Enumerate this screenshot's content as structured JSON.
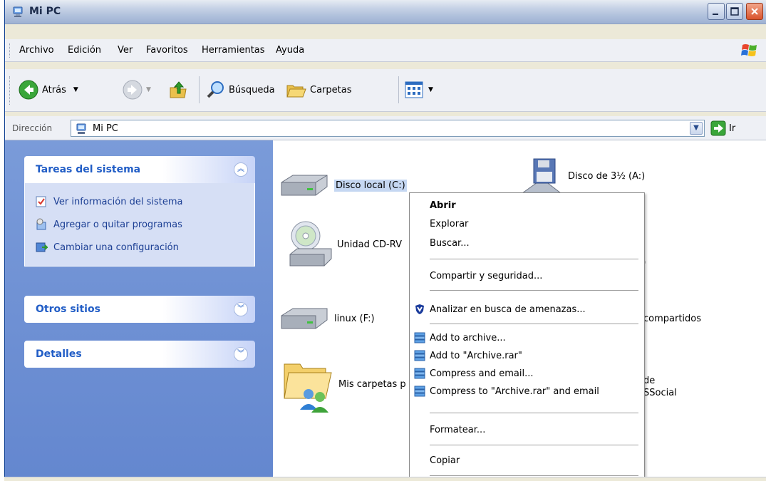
{
  "window": {
    "title": "Mi PC"
  },
  "menubar": {
    "items": [
      "Archivo",
      "Edición",
      "Ver",
      "Favoritos",
      "Herramientas",
      "Ayuda"
    ]
  },
  "toolbar": {
    "back_label": "Atrás",
    "search_label": "Búsqueda",
    "folders_label": "Carpetas"
  },
  "address": {
    "label": "Dirección",
    "value": "Mi PC",
    "go_label": "Ir"
  },
  "taskpane": {
    "system_tasks": {
      "title": "Tareas del sistema",
      "items": [
        "Ver información del sistema",
        "Agregar o quitar programas",
        "Cambiar una configuración"
      ]
    },
    "other_places": {
      "title": "Otros sitios"
    },
    "details": {
      "title": "Detalles"
    }
  },
  "content": {
    "items": [
      {
        "label": "Disco local (C:)",
        "visible": "Disco local (C:)",
        "icon": "hard-drive-icon"
      },
      {
        "label": "Unidad CD-RW",
        "visible": "Unidad CD-RV",
        "icon": "cd-drive-icon"
      },
      {
        "label": "linux (F:)",
        "visible": "linux (F:)",
        "icon": "hard-drive-icon"
      },
      {
        "label": "Mis carpetas",
        "visible": "Mis carpetas p",
        "icon": "shared-folder-icon"
      },
      {
        "label": "Disco de 3½ (A:)",
        "visible": "Disco de 3½ (A:)",
        "icon": "floppy-icon"
      },
      {
        "label": ":)",
        "visible": ":)",
        "icon": ""
      },
      {
        "label": "compartidos",
        "visible": "compartidos",
        "icon": ""
      },
      {
        "label": "de",
        "visible": "de",
        "icon": ""
      },
      {
        "label": "SSocial",
        "visible": "SSocial",
        "icon": ""
      }
    ]
  },
  "context_menu": {
    "items": [
      {
        "label": "Abrir",
        "bold": true
      },
      {
        "label": "Explorar"
      },
      {
        "label": "Buscar..."
      },
      {
        "label": "Compartir y seguridad..."
      },
      {
        "label": "Analizar en busca de amenazas...",
        "icon": "shield-icon"
      },
      {
        "label": "Add to archive...",
        "icon": "winrar-icon"
      },
      {
        "label": "Add to \"Archive.rar\"",
        "icon": "winrar-icon"
      },
      {
        "label": "Compress and email...",
        "icon": "winrar-icon"
      },
      {
        "label": "Compress to \"Archive.rar\" and email",
        "icon": "winrar-icon"
      },
      {
        "label": "Formatear..."
      },
      {
        "label": "Copiar"
      }
    ]
  }
}
